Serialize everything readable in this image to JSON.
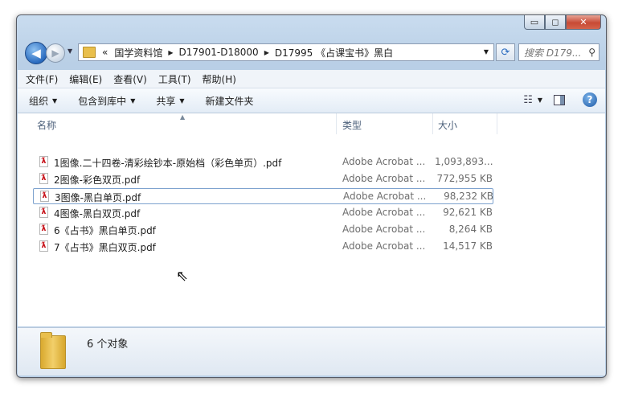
{
  "window": {
    "caption": {
      "minimize": "▭",
      "maximize": "◻",
      "close": "✕"
    }
  },
  "nav": {
    "back_glyph": "◀",
    "forward_glyph": "▶",
    "breadcrumb_overflow": "«",
    "breadcrumbs": [
      "国学资料馆",
      "D17901-D18000",
      "D17995 《占课宝书》黑白"
    ],
    "search_placeholder": "搜索 D179..."
  },
  "menu": [
    "文件(F)",
    "编辑(E)",
    "查看(V)",
    "工具(T)",
    "帮助(H)"
  ],
  "toolbar": {
    "organize": "组织",
    "include_library": "包含到库中",
    "share": "共享",
    "new_folder": "新建文件夹"
  },
  "columns": {
    "name": "名称",
    "type": "类型",
    "size": "大小"
  },
  "files": [
    {
      "name": "1图像.二十四卷-清彩绘钞本-原始档（彩色单页）.pdf",
      "type": "Adobe Acrobat ...",
      "size": "1,093,893..."
    },
    {
      "name": "2图像-彩色双页.pdf",
      "type": "Adobe Acrobat ...",
      "size": "772,955 KB"
    },
    {
      "name": "3图像-黑白单页.pdf",
      "type": "Adobe Acrobat ...",
      "size": "98,232 KB"
    },
    {
      "name": "4图像-黑白双页.pdf",
      "type": "Adobe Acrobat ...",
      "size": "92,621 KB"
    },
    {
      "name": "6《占书》黑白单页.pdf",
      "type": "Adobe Acrobat ...",
      "size": "8,264 KB"
    },
    {
      "name": "7《占书》黑白双页.pdf",
      "type": "Adobe Acrobat ...",
      "size": "14,517 KB"
    }
  ],
  "selected_index": 2,
  "status": {
    "count": "6 个对象"
  },
  "colors": {
    "accent": "#2a6bbf",
    "pdf_red": "#c8161d",
    "selection_border": "#7da2ce"
  }
}
